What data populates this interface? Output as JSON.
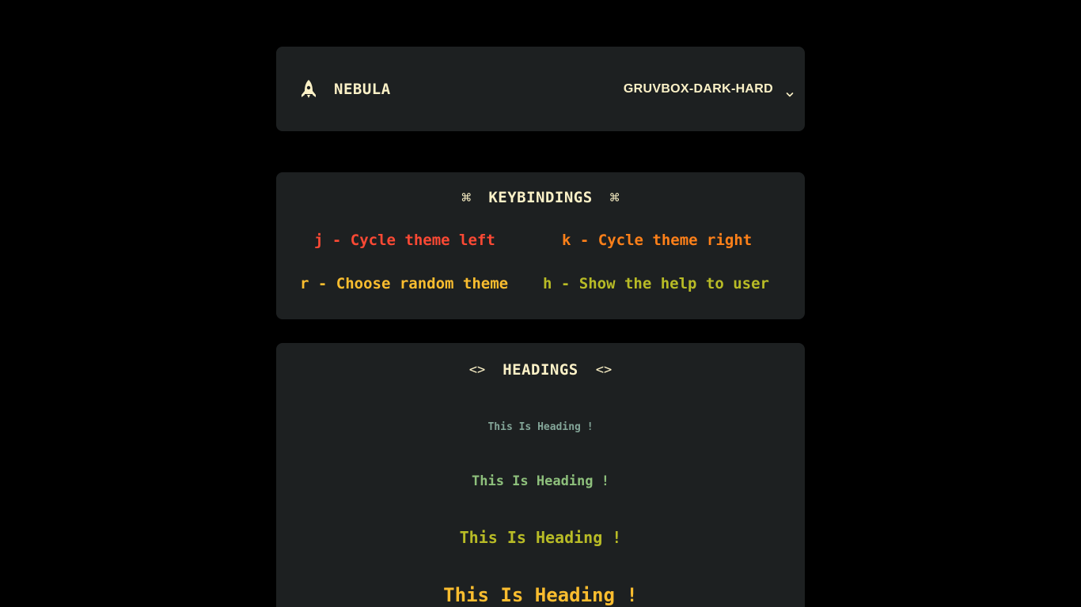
{
  "header": {
    "brand_name": "NEBULA",
    "brand_icon": "rocket-icon",
    "theme_selected": "GRUVBOX-DARK-HARD",
    "theme_icon": "chevron-down-icon"
  },
  "keybindings": {
    "title": "KEYBINDINGS",
    "title_glyph": "⌘",
    "items": [
      {
        "text": "j - Cycle theme left",
        "color": "#fb4934"
      },
      {
        "text": "k - Cycle theme right",
        "color": "#fe8019"
      },
      {
        "text": "r - Choose random theme",
        "color": "#fabd2f"
      },
      {
        "text": "h - Show the help to user",
        "color": "#b8bb26"
      }
    ]
  },
  "headings": {
    "title": "HEADINGS",
    "title_glyph": "<>",
    "items": [
      {
        "text": "This Is Heading !",
        "color": "#83a598"
      },
      {
        "text": "This Is Heading !",
        "color": "#8ec07c"
      },
      {
        "text": "This Is Heading !",
        "color": "#b8bb26"
      },
      {
        "text": "This Is Heading !",
        "color": "#fabd2f"
      }
    ]
  },
  "colors": {
    "page_background": "#000000",
    "card_background": "#1d2021",
    "foreground": "#fbf1c7"
  }
}
